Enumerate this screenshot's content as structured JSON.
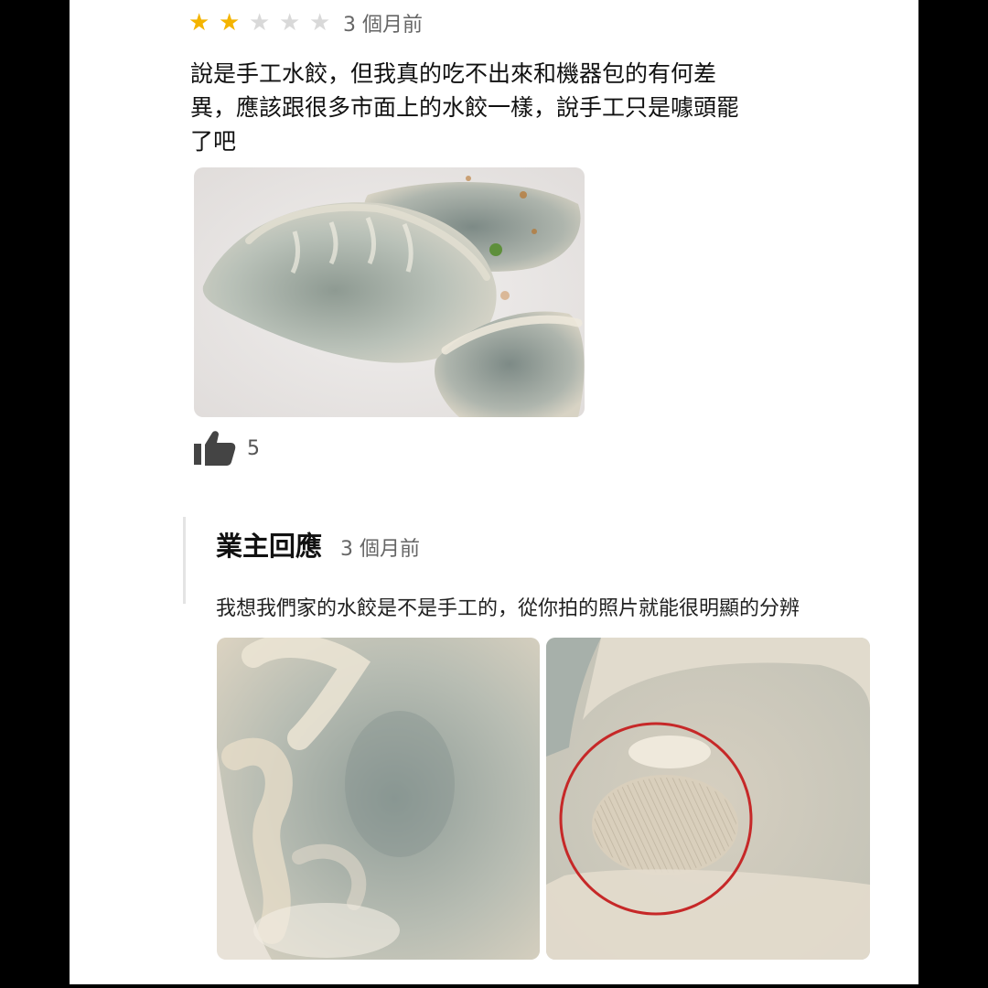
{
  "review": {
    "rating": 2,
    "max_rating": 5,
    "time": "3 個月前",
    "text_lines": [
      "說是手工水餃，但我真的吃不出來和機器包的有何差",
      "異，應該跟很多市面上的水餃一樣，說手工只是噱頭罷",
      "了吧"
    ],
    "likes": "5",
    "like_icon": "thumbs-up-icon",
    "star_icon": "star-icon"
  },
  "owner_reply": {
    "name": "業主回應",
    "time": "3 個月前",
    "text": "我想我們家的水餃是不是手工的，從你拍的照片就能很明顯的分辨"
  },
  "colors": {
    "star_filled": "#f4b400",
    "star_empty": "#d9d9d9",
    "circle_highlight": "#c62828"
  }
}
